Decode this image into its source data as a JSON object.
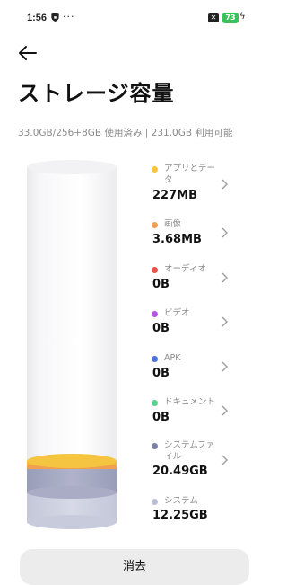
{
  "status": {
    "time": "1:56",
    "dots": "···",
    "battery": "73"
  },
  "page": {
    "title": "ストレージ容量",
    "summary": "33.0GB/256+8GB 使用済み | 231.0GB 利用可能"
  },
  "categories": [
    {
      "label": "アプリとデータ",
      "size": "227MB",
      "color": "#f5c542"
    },
    {
      "label": "画像",
      "size": "3.68MB",
      "color": "#f0a050"
    },
    {
      "label": "オーディオ",
      "size": "0B",
      "color": "#e8534a"
    },
    {
      "label": "ビデオ",
      "size": "0B",
      "color": "#b455e6"
    },
    {
      "label": "APK",
      "size": "0B",
      "color": "#4a74d8"
    },
    {
      "label": "ドキュメント",
      "size": "0B",
      "color": "#5ad08e"
    },
    {
      "label": "システムファイル",
      "size": "20.49GB",
      "color": "#7d80a5"
    },
    {
      "label": "システム",
      "size": "12.25GB",
      "color": "#b9bfd6"
    }
  ],
  "actions": {
    "clear_label": "消去"
  },
  "colors": {
    "accent_yellow": "#f5c542",
    "battery": "#3ac15a"
  }
}
